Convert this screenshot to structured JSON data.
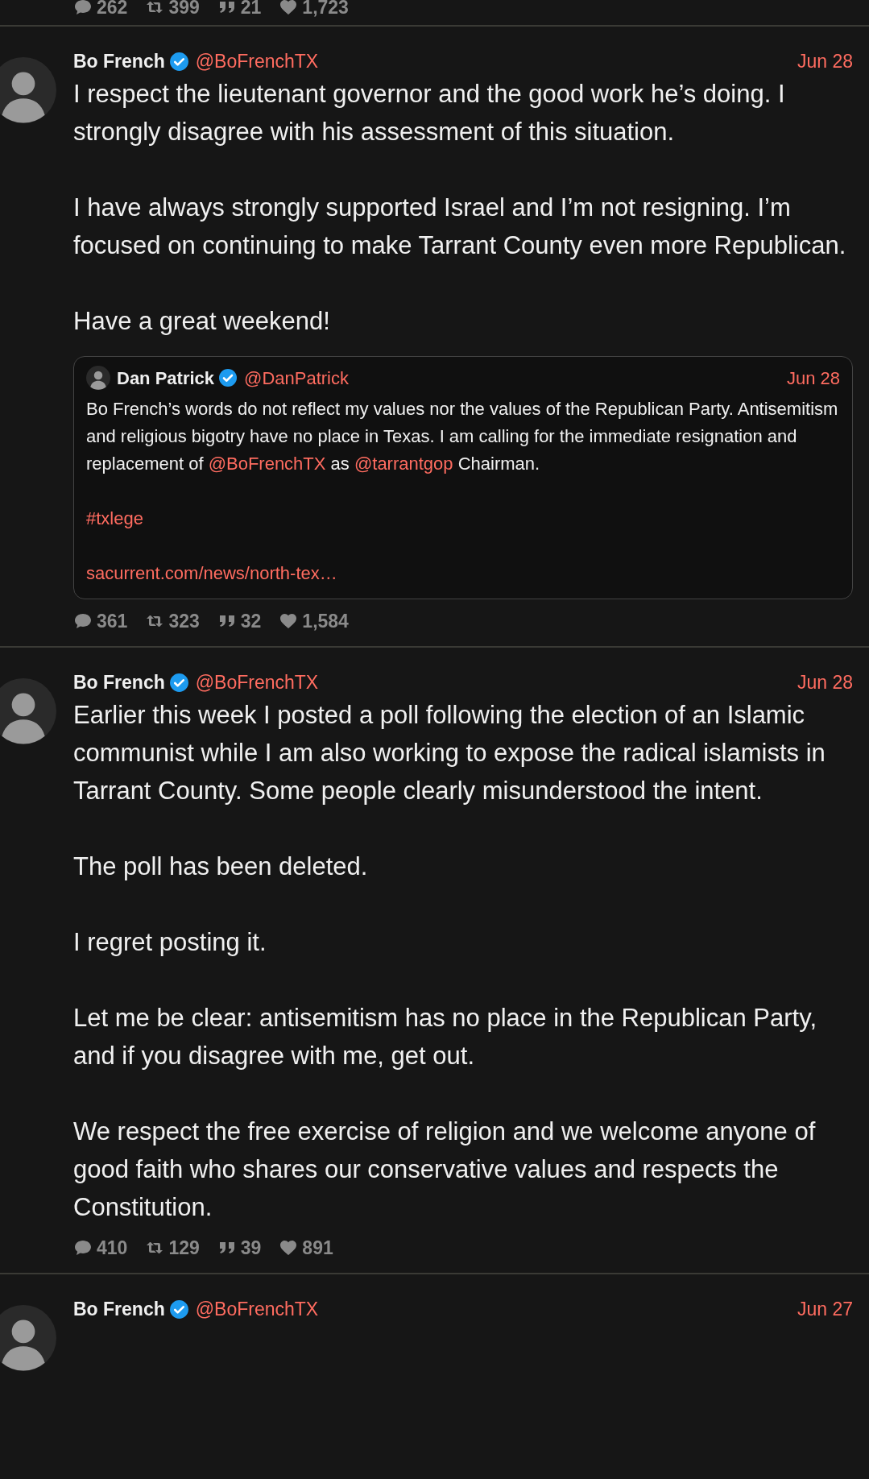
{
  "top_stats": [
    {
      "kind": "replies",
      "count": "262"
    },
    {
      "kind": "retweets",
      "count": "399"
    },
    {
      "kind": "quotes",
      "count": "21"
    },
    {
      "kind": "likes",
      "count": "1,723"
    }
  ],
  "tweets": [
    {
      "name": "Bo French",
      "verified": true,
      "handle": "@BoFrenchTX",
      "date": "Jun 28",
      "paragraphs": [
        "I respect the lieutenant governor and the good work he’s doing. I strongly disagree with his assessment of this situation.",
        "I have always strongly supported Israel and I’m not resigning. I’m focused on continuing to make Tarrant County even more Republican.",
        "Have a great weekend!"
      ],
      "quote": {
        "name": "Dan Patrick",
        "verified": true,
        "handle": "@DanPatrick",
        "date": "Jun 28",
        "paragraphs": [
          [
            {
              "kind": "text",
              "text": "Bo French’s words do not reflect my values nor the values of the Republican Party. Antisemitism and religious bigotry have no place in Texas. I am calling for the immediate resignation and replacement of "
            },
            {
              "kind": "mention",
              "text": "@BoFrenchTX"
            },
            {
              "kind": "text",
              "text": " as "
            },
            {
              "kind": "mention",
              "text": "@tarrantgop"
            },
            {
              "kind": "text",
              "text": " Chairman."
            }
          ],
          [
            {
              "kind": "hashtag",
              "text": "#txlege"
            }
          ],
          [
            {
              "kind": "url",
              "text": "sacurrent.com/news/north-tex…"
            }
          ]
        ]
      },
      "stats": [
        {
          "kind": "replies",
          "count": "361"
        },
        {
          "kind": "retweets",
          "count": "323"
        },
        {
          "kind": "quotes",
          "count": "32"
        },
        {
          "kind": "likes",
          "count": "1,584"
        }
      ]
    },
    {
      "name": "Bo French",
      "verified": true,
      "handle": "@BoFrenchTX",
      "date": "Jun 28",
      "paragraphs": [
        "Earlier this week I posted a poll following the election of an Islamic communist while I am also working to expose the radical islamists in Tarrant County. Some people clearly misunderstood the intent.",
        "The poll has been deleted.",
        "I regret posting it.",
        "Let me be clear: antisemitism has no place in the Republican Party, and if you disagree with me, get out.",
        "We respect the free exercise of religion and we welcome anyone of good faith who shares our conservative values and respects the Constitution."
      ],
      "stats": [
        {
          "kind": "replies",
          "count": "410"
        },
        {
          "kind": "retweets",
          "count": "129"
        },
        {
          "kind": "quotes",
          "count": "39"
        },
        {
          "kind": "likes",
          "count": "891"
        }
      ]
    },
    {
      "name": "Bo French",
      "verified": true,
      "handle": "@BoFrenchTX",
      "date": "Jun 27"
    }
  ]
}
